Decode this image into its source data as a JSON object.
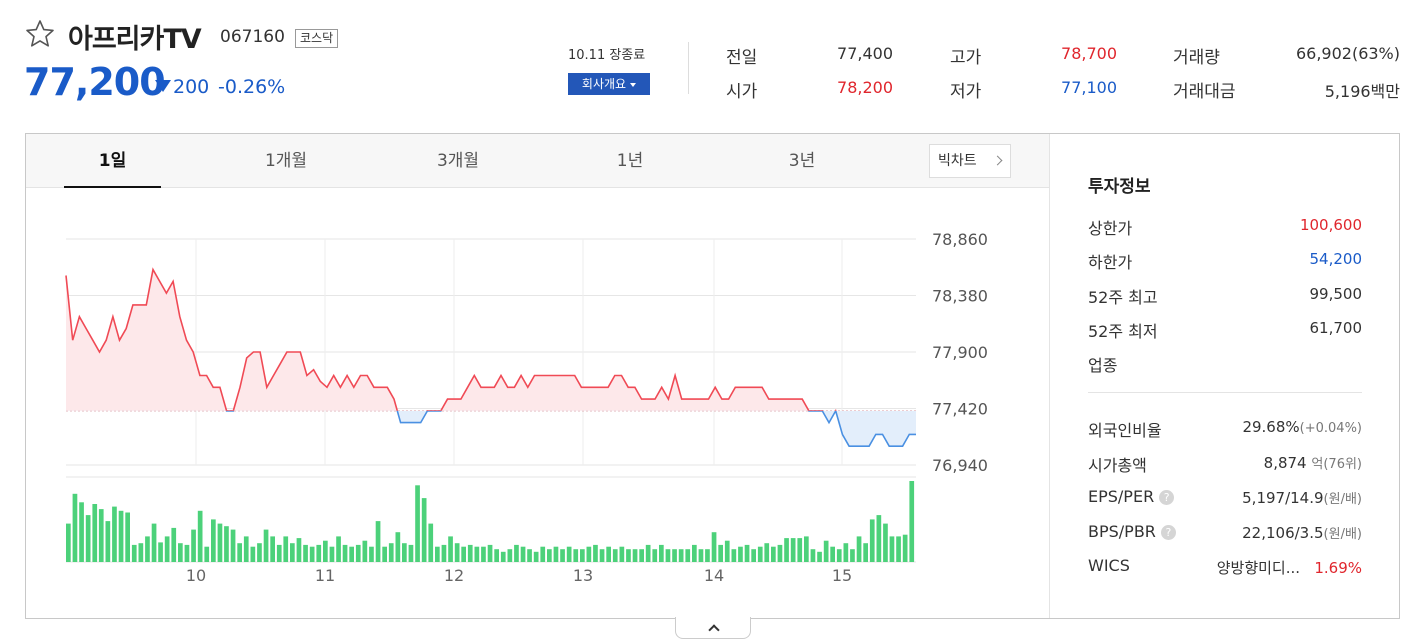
{
  "stock": {
    "name": "아프리카TV",
    "code": "067160",
    "market": "코스닥",
    "price": "77,200",
    "change": "200",
    "change_pct": "-0.26%",
    "direction": "down",
    "star_icon": "star-outline-icon"
  },
  "session": {
    "closed_label": "10.11 장종료",
    "company_button": "회사개요"
  },
  "stats": [
    {
      "label": "전일",
      "value": "77,400",
      "tone": "neutral"
    },
    {
      "label": "고가",
      "value": "78,700",
      "tone": "up"
    },
    {
      "label": "거래량",
      "value": "66,902(63%)",
      "tone": "neutral"
    },
    {
      "label": "시가",
      "value": "78,200",
      "tone": "up"
    },
    {
      "label": "저가",
      "value": "77,100",
      "tone": "down"
    },
    {
      "label": "거래대금",
      "value": "5,196백만",
      "tone": "neutral"
    }
  ],
  "tabs": [
    "1일",
    "1개월",
    "3개월",
    "1년",
    "3년"
  ],
  "active_tab": 0,
  "bigchart_label": "빅차트",
  "chart_data": {
    "type": "line",
    "base_price": 77400,
    "ylim": [
      76940,
      78860
    ],
    "y_ticks": [
      "78,860",
      "78,380",
      "77,900",
      "77,420",
      "76,940"
    ],
    "x_labels": [
      "10",
      "11",
      "12",
      "13",
      "14",
      "15"
    ],
    "colors": {
      "up": "#f04a55",
      "up_fill": "#fde8ea",
      "down": "#4a90e2",
      "down_fill": "#e3eefb",
      "volume": "#4cd17a"
    },
    "prices": [
      78550,
      78000,
      78200,
      78100,
      78000,
      77900,
      78000,
      78200,
      78000,
      78100,
      78300,
      78300,
      78300,
      78600,
      78500,
      78400,
      78500,
      78200,
      78000,
      77900,
      77700,
      77700,
      77600,
      77600,
      77400,
      77400,
      77600,
      77850,
      77900,
      77900,
      77600,
      77700,
      77800,
      77900,
      77900,
      77900,
      77700,
      77750,
      77650,
      77600,
      77700,
      77600,
      77700,
      77600,
      77700,
      77700,
      77600,
      77600,
      77600,
      77500,
      77300,
      77300,
      77300,
      77300,
      77400,
      77400,
      77400,
      77500,
      77500,
      77500,
      77600,
      77700,
      77600,
      77600,
      77600,
      77700,
      77600,
      77600,
      77700,
      77600,
      77700,
      77700,
      77700,
      77700,
      77700,
      77700,
      77700,
      77600,
      77600,
      77600,
      77600,
      77600,
      77700,
      77700,
      77600,
      77600,
      77500,
      77500,
      77500,
      77600,
      77500,
      77700,
      77500,
      77500,
      77500,
      77500,
      77500,
      77600,
      77500,
      77500,
      77600,
      77600,
      77600,
      77600,
      77600,
      77500,
      77500,
      77500,
      77500,
      77500,
      77500,
      77400,
      77400,
      77400,
      77300,
      77400,
      77200,
      77100,
      77100,
      77100,
      77100,
      77200,
      77200,
      77100,
      77100,
      77100,
      77200,
      77200
    ],
    "volumes": [
      45,
      80,
      70,
      55,
      68,
      62,
      48,
      65,
      60,
      58,
      20,
      22,
      30,
      45,
      23,
      30,
      40,
      22,
      20,
      38,
      60,
      18,
      50,
      45,
      42,
      38,
      22,
      30,
      18,
      22,
      38,
      30,
      20,
      30,
      22,
      28,
      20,
      18,
      20,
      25,
      18,
      30,
      20,
      18,
      20,
      25,
      18,
      48,
      18,
      22,
      35,
      22,
      20,
      90,
      75,
      45,
      18,
      20,
      30,
      22,
      18,
      20,
      18,
      18,
      20,
      15,
      12,
      15,
      20,
      18,
      15,
      12,
      18,
      15,
      18,
      15,
      18,
      15,
      15,
      18,
      20,
      15,
      18,
      15,
      18,
      15,
      15,
      15,
      20,
      15,
      20,
      15,
      15,
      15,
      15,
      20,
      15,
      15,
      35,
      20,
      25,
      15,
      18,
      20,
      15,
      18,
      22,
      18,
      20,
      28,
      28,
      28,
      30,
      15,
      12,
      25,
      18,
      15,
      22,
      15,
      30,
      22,
      50,
      55,
      45,
      30,
      30,
      32,
      95
    ],
    "max_volume": 95
  },
  "invest": {
    "title": "투자정보",
    "rows": [
      {
        "label": "상한가",
        "value": "100,600",
        "tone": "up"
      },
      {
        "label": "하한가",
        "value": "54,200",
        "tone": "down"
      },
      {
        "label": "52주 최고",
        "value": "99,500",
        "tone": "neutral"
      },
      {
        "label": "52주 최저",
        "value": "61,700",
        "tone": "neutral"
      },
      {
        "label": "업종",
        "value": "",
        "tone": "neutral"
      }
    ],
    "rows2": [
      {
        "label": "외국인비율",
        "value": "29.68%",
        "sub": "(+0.04%)"
      },
      {
        "label": "시가총액",
        "value": "8,874",
        "sub": "억(76위)"
      },
      {
        "label": "EPS/PER",
        "value": "5,197/14.9",
        "sub": "(원/배)",
        "help": "?"
      },
      {
        "label": "BPS/PBR",
        "value": "22,106/3.5",
        "sub": "(원/배)",
        "help": "?"
      },
      {
        "label": "WICS",
        "value": "양방향미디...",
        "sub": "1.69%",
        "sub_tone": "up"
      }
    ]
  },
  "collapse_icon": "chevron-up-icon"
}
